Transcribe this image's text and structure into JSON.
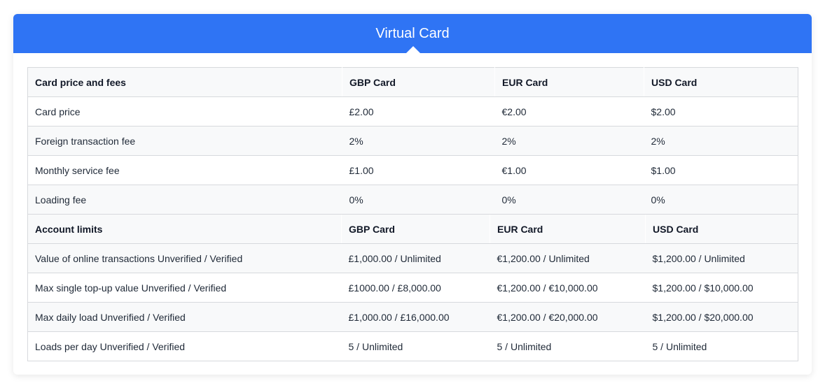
{
  "header": {
    "title": "Virtual Card"
  },
  "fees": {
    "columns": [
      "Card price and fees",
      "GBP Card",
      "EUR Card",
      "USD Card"
    ],
    "rows": [
      [
        "Card price",
        "£2.00",
        "€2.00",
        "$2.00"
      ],
      [
        "Foreign transaction fee",
        "2%",
        "2%",
        "2%"
      ],
      [
        "Monthly service fee",
        "£1.00",
        "€1.00",
        "$1.00"
      ],
      [
        "Loading fee",
        "0%",
        "0%",
        "0%"
      ]
    ]
  },
  "limits": {
    "columns": [
      "Account limits",
      "GBP Card",
      "EUR Card",
      "USD Card"
    ],
    "rows": [
      [
        "Value of online transactions Unverified / Verified",
        "£1,000.00 / Unlimited",
        "€1,200.00 / Unlimited",
        "$1,200.00 / Unlimited"
      ],
      [
        "Max single top-up value Unverified / Verified",
        "£1000.00 / £8,000.00",
        "€1,200.00 / €10,000.00",
        "$1,200.00 / $10,000.00"
      ],
      [
        "Max daily load Unverified / Verified",
        "£1,000.00 / £16,000.00",
        "€1,200.00 / €20,000.00",
        "$1,200.00 / $20,000.00"
      ],
      [
        "Loads per day Unverified / Verified",
        "5 / Unlimited",
        "5 / Unlimited",
        "5 / Unlimited"
      ]
    ]
  }
}
